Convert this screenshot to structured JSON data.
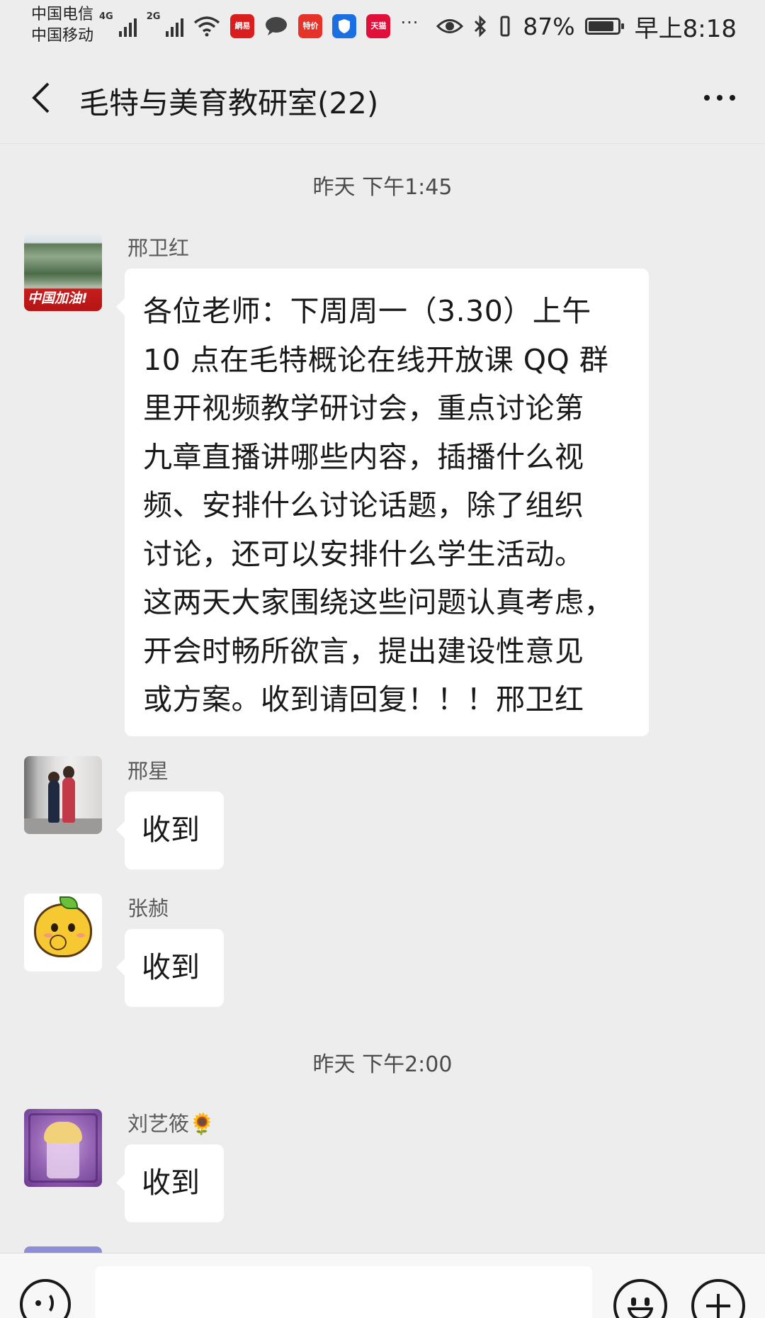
{
  "status_bar": {
    "carrier1": "中国电信",
    "carrier2": "中国移动",
    "net1": "4G",
    "net2": "2G",
    "app_icons": [
      {
        "name": "netease-news-icon",
        "label": "網易",
        "color": "#d81e1e"
      },
      {
        "name": "message-bubble-icon",
        "label": "",
        "color": "#444444"
      },
      {
        "name": "pinduoduo-sale-icon",
        "label": "特价",
        "color": "#e6332a"
      },
      {
        "name": "shield-app-icon",
        "label": "",
        "color": "#1b6fe0"
      },
      {
        "name": "tmall-icon",
        "label": "天猫",
        "color": "#e0103a"
      }
    ],
    "more": "···",
    "battery_percent": "87%",
    "battery_level": 0.87,
    "time": "早上8:18"
  },
  "header": {
    "title": "毛特与美育教研室(22)"
  },
  "messages": {
    "sep1": "昨天 下午1:45",
    "sep2": "昨天 下午2:00",
    "m1": {
      "sender": "邢卫红",
      "avatar_text": "中国加油!",
      "lines": [
        "各位老师：下周周一（3.30）上午",
        "10 点在毛特概论在线开放课 QQ 群",
        "里开视频教学研讨会，重点讨论第",
        "九章直播讲哪些内容，插播什么视",
        "频、安排什么讨论话题，除了组织",
        "讨论，还可以安排什么学生活动。",
        "这两天大家围绕这些问题认真考虑，",
        "开会时畅所欲言，提出建设性意见",
        "或方案。收到请回复！！！邢卫红"
      ]
    },
    "m2": {
      "sender": "邢星",
      "text": "收到"
    },
    "m3": {
      "sender": "张赪",
      "text": "收到"
    },
    "m4": {
      "sender": "刘艺筱🌻",
      "text": "收到"
    }
  },
  "input_bar": {
    "placeholder": ""
  }
}
